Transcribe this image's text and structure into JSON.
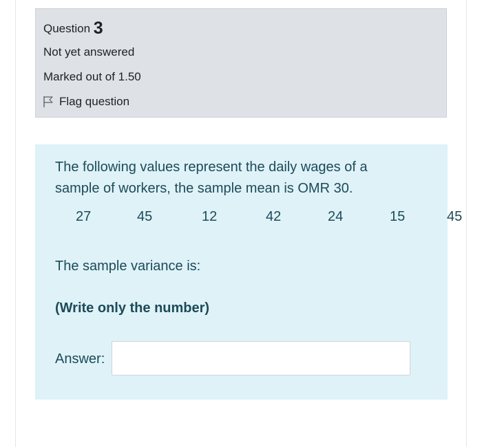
{
  "info": {
    "question_label": "Question",
    "question_number": "3",
    "state": "Not yet answered",
    "grade": "Marked out of 1.50",
    "flag_label": "Flag question",
    "flag_icon": "flag-icon"
  },
  "question": {
    "line1": "The following values represent the daily wages of a",
    "line2": "sample of workers, the sample mean is OMR 30.",
    "values": [
      "27",
      "45",
      "12",
      "42",
      "24",
      "15",
      "45"
    ],
    "prompt": "The sample variance is:",
    "instruction": "(Write only the number)",
    "answer_label": "Answer:",
    "answer_value": ""
  },
  "colors": {
    "info_bg": "#dee2e6",
    "content_bg": "#def2f8",
    "content_text": "#1d4a58"
  }
}
